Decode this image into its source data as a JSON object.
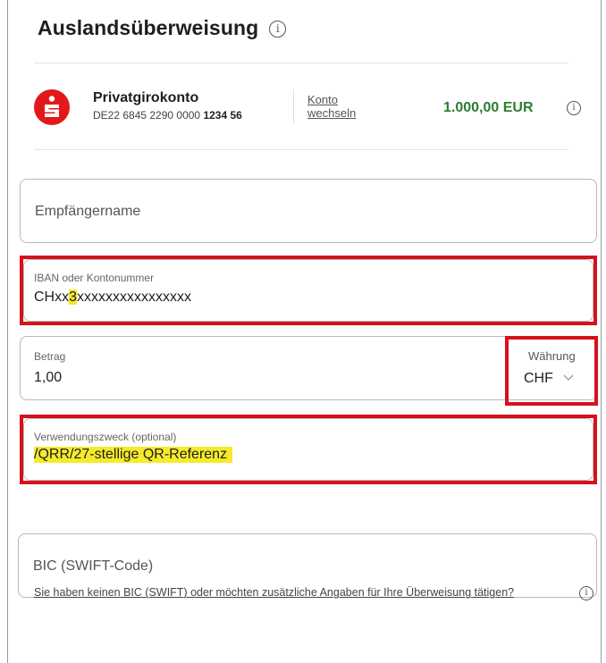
{
  "page": {
    "title": "Auslandsüberweisung"
  },
  "account": {
    "name": "Privatgirokonto",
    "iban_prefix": "DE22 6845 2290 0000",
    "iban_suffix": "1234 56",
    "switch_line1": "Konto",
    "switch_line2": "wechseln",
    "balance": "1.000,00 EUR"
  },
  "form": {
    "recipient_placeholder": "Empfängername",
    "iban": {
      "label": "IBAN oder Kontonummer",
      "value_prefix": "CHxx",
      "value_highlight": "3",
      "value_suffix": "xxxxxxxxxxxxxxxx"
    },
    "amount": {
      "label": "Betrag",
      "value": "1,00"
    },
    "currency": {
      "label": "Währung",
      "value": "CHF"
    },
    "purpose": {
      "label": "Verwendungszweck (optional)",
      "value": "/QRR/27-stellige QR-Referenz"
    },
    "bic_placeholder": "BIC (SWIFT-Code)",
    "bic_help_link": "Sie haben keinen BIC (SWIFT) oder möchten zusätzliche Angaben für Ihre Überweisung tätigen?"
  },
  "colors": {
    "brand_red": "#e2181b",
    "highlight_red_box": "#d7101d",
    "text_highlight": "#f5ea2c",
    "balance_green": "#2e7d32"
  },
  "icons": [
    "info-icon",
    "sparkasse-logo",
    "chevron-down-icon"
  ]
}
